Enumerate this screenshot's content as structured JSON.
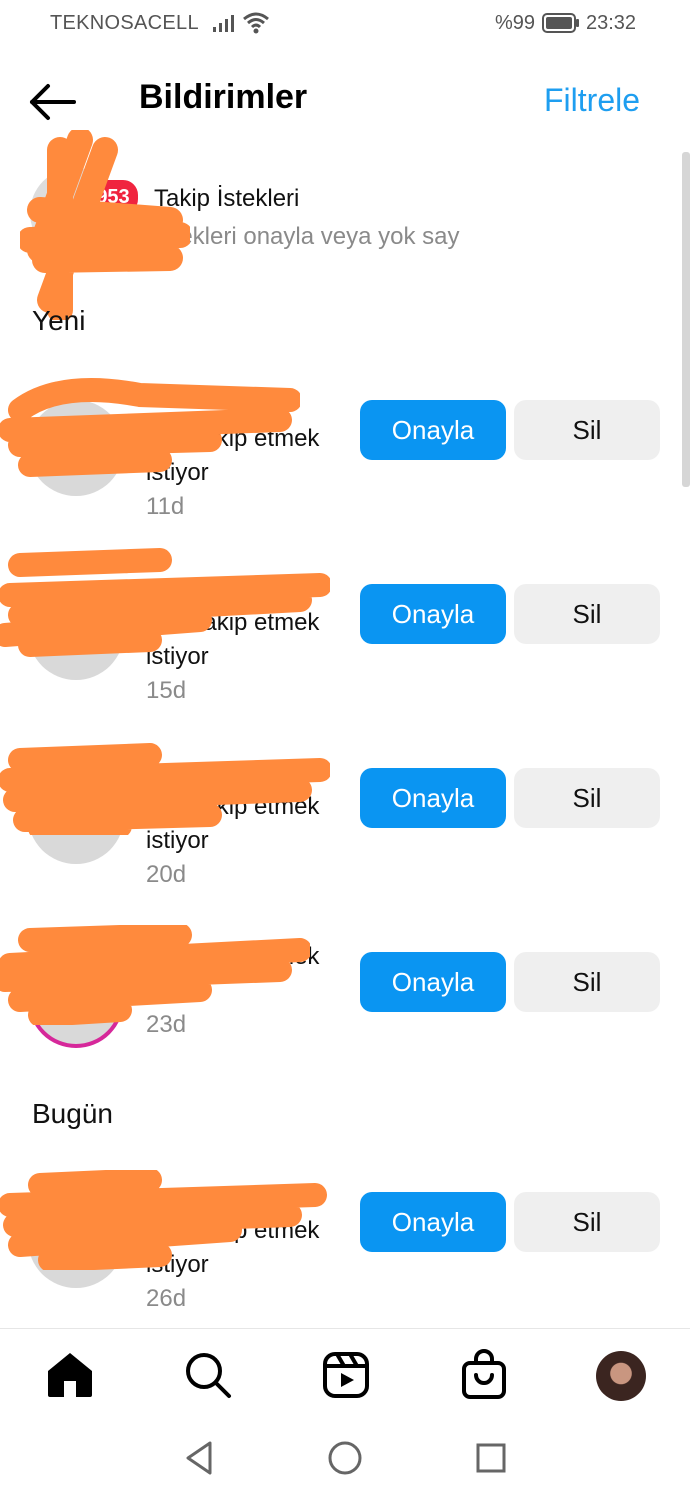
{
  "status_bar": {
    "carrier": "TEKNOSACELL",
    "battery_text": "%99",
    "time": "23:32"
  },
  "header": {
    "title": "Bildirimler",
    "filter_label": "Filtrele",
    "back_icon": "arrow-left-icon"
  },
  "follow_requests": {
    "badge": "953",
    "title": "Takip İstekleri",
    "subtitle": "İstekleri onayla veya yok say"
  },
  "sections": {
    "new_label": "Yeni",
    "today_label": "Bugün"
  },
  "requests": [
    {
      "text": "seni takip etmek istiyor",
      "time": "11d"
    },
    {
      "text": "seni takip etmek istiyor",
      "time": "15d"
    },
    {
      "text": "seni takip etmek istiyor",
      "time": "20d"
    },
    {
      "text": "seni takip etmek istiyor",
      "time": "23d"
    },
    {
      "text": "seni takip etmek istiyor",
      "time": "26d"
    }
  ],
  "actions": {
    "approve_label": "Onayla",
    "delete_label": "Sil"
  },
  "tabbar": {
    "icons": [
      "home-icon",
      "search-icon",
      "reels-icon",
      "shop-icon",
      "profile-avatar"
    ]
  },
  "colors": {
    "accent": "#0a95f2",
    "filter": "#1e9ef0",
    "badge": "#f0243f",
    "redaction": "#ff8a3d"
  }
}
